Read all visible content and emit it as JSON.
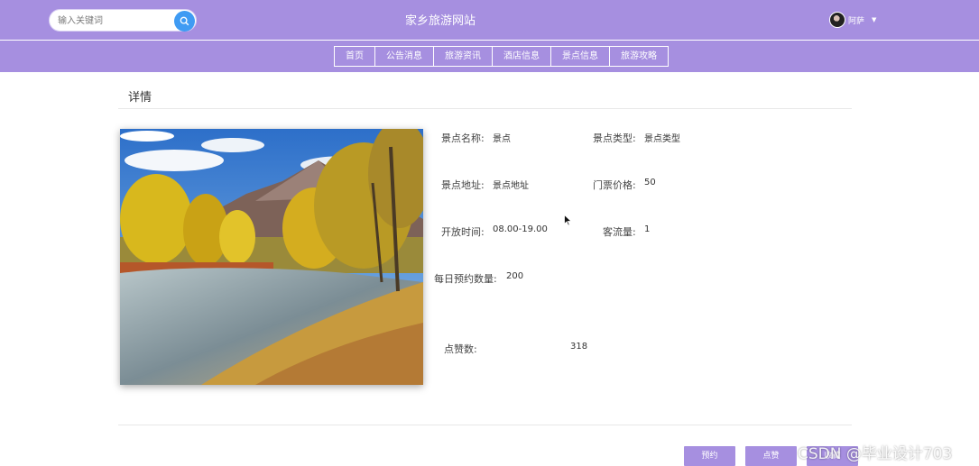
{
  "header": {
    "search_placeholder": "输入关键词",
    "site_title": "家乡旅游网站",
    "username": "阿萨"
  },
  "nav": {
    "items": [
      "首页",
      "公告消息",
      "旅游资讯",
      "酒店信息",
      "景点信息",
      "旅游攻略"
    ]
  },
  "detail": {
    "section_title": "详情",
    "name_label": "景点名称:",
    "name_value": "景点",
    "type_label": "景点类型:",
    "type_value": "景点类型",
    "address_label": "景点地址:",
    "address_value": "景点地址",
    "price_label": "门票价格:",
    "price_value": "50",
    "hours_label": "开放时间:",
    "hours_value": "08.00-19.00",
    "traffic_label": "客流量:",
    "traffic_value": "1",
    "daily_label": "每日预约数量:",
    "daily_value": "200",
    "likes_label": "点赞数:",
    "likes_value": "318"
  },
  "actions": {
    "book": "预约",
    "like": "点赞",
    "favorite": "收藏"
  },
  "watermark": "CSDN @毕业设计703",
  "colors": {
    "accent": "#a68fe0",
    "search_button": "#3f9bf3"
  }
}
